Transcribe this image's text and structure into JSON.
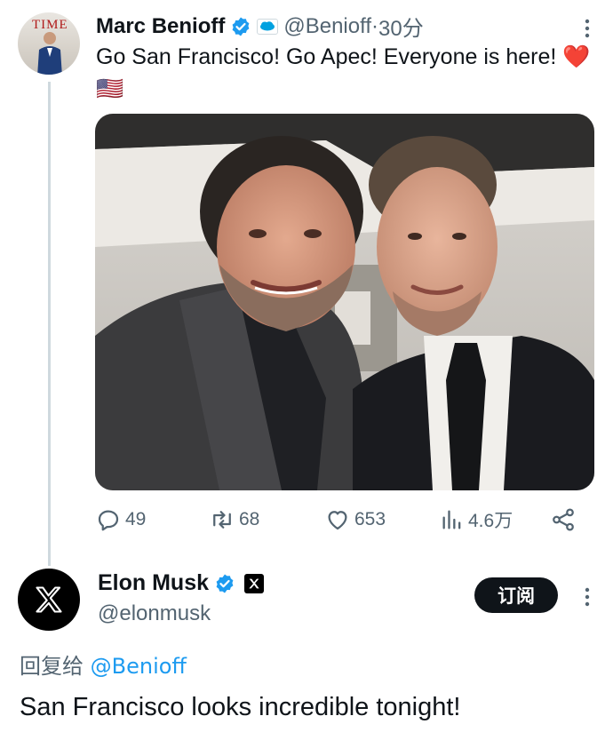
{
  "tweet1": {
    "author_name": "Marc Benioff",
    "handle": "@Benioff",
    "separator": " · ",
    "time": "30分",
    "text": "Go San Francisco! Go Apec! Everyone is here! ❤️🇺🇸",
    "avatar_masthead": "TIME",
    "stats": {
      "replies": "49",
      "retweets": "68",
      "likes": "653",
      "views": "4.6万"
    }
  },
  "tweet2": {
    "author_name": "Elon Musk",
    "handle": "@elonmusk",
    "subscribe_label": "订阅",
    "reply_prefix": "回复给 ",
    "reply_mention": "@Benioff",
    "text": "San Francisco looks incredible tonight!"
  },
  "colors": {
    "accent": "#1d9bf0",
    "secondary_text": "#536471",
    "primary_text": "#0f1419",
    "thread_line": "#cfd9de"
  },
  "icons": [
    "verified-icon",
    "salesforce-affiliate-icon",
    "more-icon",
    "reply-icon",
    "retweet-icon",
    "like-icon",
    "views-icon",
    "share-icon",
    "x-logo-icon"
  ]
}
